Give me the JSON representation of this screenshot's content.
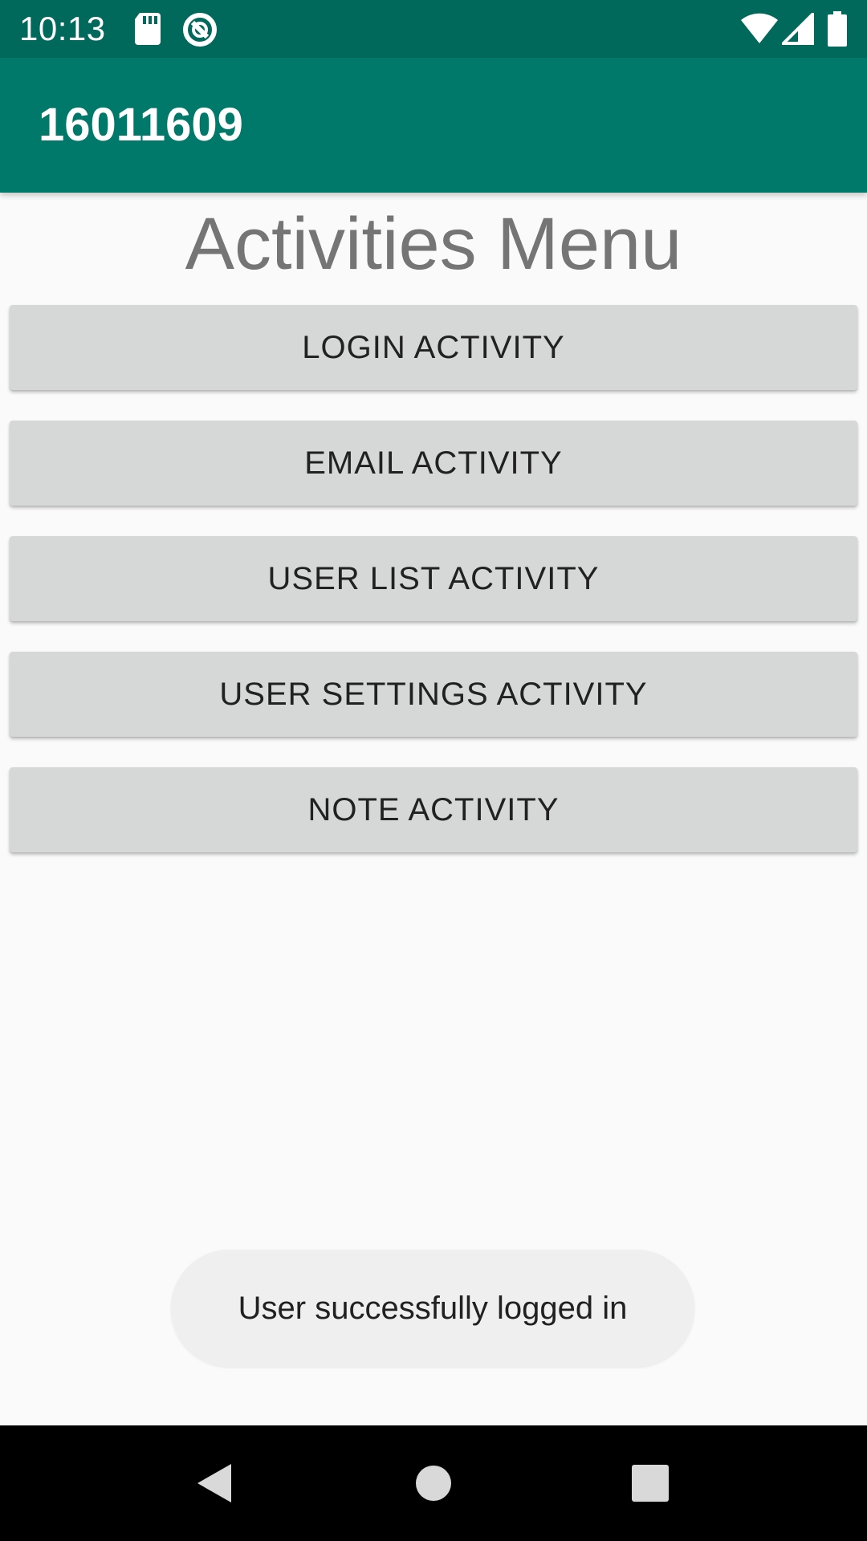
{
  "status_bar": {
    "time": "10:13",
    "icons": [
      "sd-card-icon",
      "data-saver-icon",
      "wifi-icon",
      "cell-signal-icon",
      "battery-icon"
    ]
  },
  "app_bar": {
    "title": "16011609",
    "color": "#00796b"
  },
  "main": {
    "heading": "Activities Menu",
    "buttons": [
      {
        "label": "LOGIN ACTIVITY"
      },
      {
        "label": "EMAIL ACTIVITY"
      },
      {
        "label": "USER LIST ACTIVITY"
      },
      {
        "label": "USER SETTINGS ACTIVITY"
      },
      {
        "label": "NOTE ACTIVITY"
      }
    ]
  },
  "toast": {
    "message": "User successfully logged in"
  },
  "nav_bar": {
    "icons": [
      "back-icon",
      "home-icon",
      "recents-icon"
    ]
  },
  "colors": {
    "status_bar": "#00695c",
    "app_bar": "#00796b",
    "button": "#d6d7d7",
    "background": "#fafafa"
  }
}
